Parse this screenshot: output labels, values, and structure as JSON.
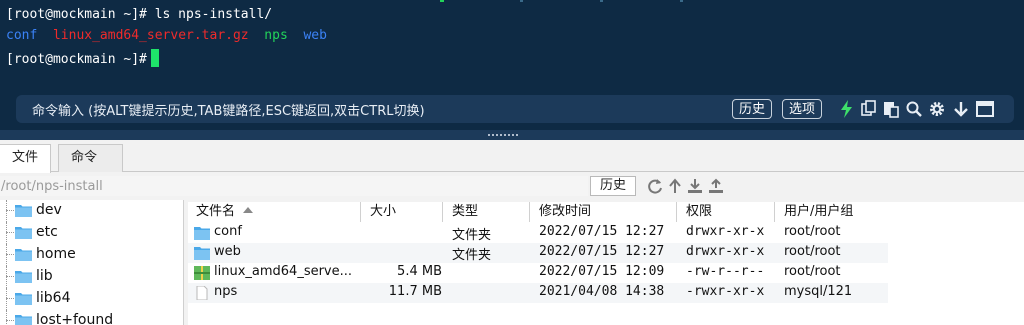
{
  "terminal": {
    "line1": "[root@mockmain ~]# ls nps-install/",
    "ls_output": [
      "conf",
      "linux_amd64_server.tar.gz",
      "nps",
      "web"
    ],
    "prompt": "[root@mockmain ~]#"
  },
  "cmdbar": {
    "hint": "命令输入 (按ALT键提示历史,TAB键路径,ESC键返回,双击CTRL切换)",
    "history_label": "历史",
    "options_label": "选项",
    "icons": [
      "lightning-icon",
      "copy-icon",
      "paste-icon",
      "search-icon",
      "gear-icon",
      "download-icon",
      "window-icon"
    ]
  },
  "tabs": [
    "文件",
    "命令"
  ],
  "path": {
    "value": "/root/nps-install",
    "history_label": "历史"
  },
  "tree": [
    "dev",
    "etc",
    "home",
    "lib",
    "lib64",
    "lost+found"
  ],
  "table": {
    "columns": [
      "文件名",
      "大小",
      "类型",
      "修改时间",
      "权限",
      "用户/用户组"
    ],
    "rows": [
      {
        "name": "conf",
        "size": "",
        "type": "文件夹",
        "mtime": "2022/07/15 12:27",
        "perm": "drwxr-xr-x",
        "owner": "root/root",
        "icon": "folder-icon"
      },
      {
        "name": "web",
        "size": "",
        "type": "文件夹",
        "mtime": "2022/07/15 12:27",
        "perm": "drwxr-xr-x",
        "owner": "root/root",
        "icon": "folder-icon"
      },
      {
        "name": "linux_amd64_serve...",
        "size": "5.4 MB",
        "type": "",
        "mtime": "2022/07/15 12:09",
        "perm": "-rw-r--r--",
        "owner": "root/root",
        "icon": "archive-icon"
      },
      {
        "name": "nps",
        "size": "11.7 MB",
        "type": "",
        "mtime": "2021/04/08 14:38",
        "perm": "-rwxr-xr-x",
        "owner": "mysql/121",
        "icon": "file-icon"
      }
    ]
  },
  "colors": {
    "terminal_bg": "#0e2a44",
    "folder": "#4aa8e8",
    "cursor": "#1ee36a"
  }
}
